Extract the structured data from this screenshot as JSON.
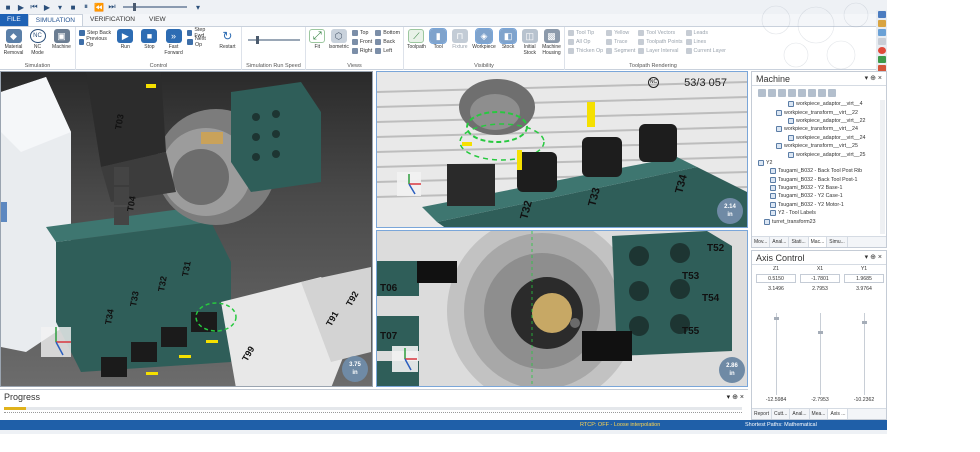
{
  "quick_access": {
    "icons": [
      "play-icon",
      "step-back-icon",
      "play-small-icon",
      "stop-icon",
      "pause-icon",
      "forward-icon",
      "rewind-icon",
      "end-icon",
      "dropdown-icon"
    ],
    "speed_level": 0.2
  },
  "ribbon": {
    "tabs": [
      {
        "label": "FILE",
        "state": "file"
      },
      {
        "label": "SIMULATION",
        "state": "active"
      },
      {
        "label": "VERIFICATION",
        "state": ""
      },
      {
        "label": "VIEW",
        "state": ""
      }
    ],
    "groups": {
      "simulation": {
        "title": "Simulation",
        "buttons": [
          "Material Removal",
          "NC Mode",
          "Machine"
        ]
      },
      "control": {
        "title": "Control",
        "step_back": "Step Back",
        "previous_op": "Previous Op",
        "run": "Run",
        "stop": "Stop",
        "fast_forward": "Fast Forward",
        "step_fwd": "Step Fwd",
        "next_op": "Next Op",
        "restart": "Restart"
      },
      "speed": {
        "title": "Simulation Run Speed",
        "level": 0.15
      },
      "views": {
        "title": "Views",
        "fit": "Fit",
        "isometric": "Isometric",
        "top": "Top",
        "front": "Front",
        "right": "Right",
        "bottom": "Bottom",
        "back": "Back",
        "left": "Left"
      },
      "visibility": {
        "title": "Visibility",
        "buttons": [
          "Toolpath",
          "Tool",
          "Fixture",
          "Workpiece",
          "Stock",
          "Initial Stock",
          "Machine Housing"
        ]
      },
      "toolpath_rendering": {
        "title": "Toolpath Rendering",
        "items": [
          "Tool Tip",
          "Yellow",
          "Tool Vectors",
          "Leads",
          "All Op",
          "Trace",
          "Toolpath Points",
          "Lines",
          "Thicken Op",
          "Segment",
          "Layer Interval",
          "Current Layer"
        ]
      }
    }
  },
  "viewports": {
    "left": {
      "scale": "3.75",
      "unit": "in",
      "tool_labels": [
        "T03",
        "T04",
        "T31",
        "T32",
        "T33",
        "T34",
        "T91",
        "T92",
        "T99"
      ]
    },
    "top_right": {
      "scale": "2.14",
      "unit": "in",
      "counter": "53/3 057",
      "nc_badge": "NC",
      "tool_labels": [
        "T32",
        "T33",
        "T34"
      ]
    },
    "bottom_right": {
      "scale": "2.86",
      "unit": "in",
      "tool_labels": [
        "T52",
        "T53",
        "T54",
        "T55",
        "T06",
        "T07"
      ]
    }
  },
  "machine_panel": {
    "title": "Machine",
    "tree": [
      "workpiece_adaptor__virt__4",
      "workpiece_transform__virt__22",
      "workpiece_adaptor__virt__22",
      "workpiece_transform__virt__24",
      "workpiece_adaptor__virt__24",
      "workpiece_transform__virt__25",
      "workpiece_adaptor__virt__25",
      "Y2",
      "Tsugami_B032 - Back Tool Post Rib",
      "Tsugami_B032 - Back Tool Post-1",
      "Tsugami_B032 - Y2 Base-1",
      "Tsugami_B032 - Y2 Case-1",
      "Tsugami_B032 - Y2 Motor-1",
      "Y2 - Tool Labels",
      "turret_transform23"
    ],
    "tabs": [
      "Mov...",
      "Anal...",
      "Stati...",
      "Mac...",
      "Simu..."
    ]
  },
  "axis_control": {
    "title": "Axis Control",
    "axes": [
      {
        "name": "Z1",
        "value": "0.5150",
        "min": "3.1496",
        "max": "-12.5984"
      },
      {
        "name": "X1",
        "value": "-1.7801",
        "min": "2.7953",
        "max": "-2.7953"
      },
      {
        "name": "Y1",
        "value": "1.9685",
        "min": "3.9764",
        "max": "-10.2362"
      }
    ],
    "tabs": [
      "Report",
      "Cutt...",
      "Anal...",
      "Mea...",
      "Axis ..."
    ]
  },
  "progress": {
    "title": "Progress",
    "fraction": 0.03
  },
  "status_bar": {
    "left": "",
    "middle": "RTCP: OFF - Loose interpolation",
    "right": "Shortest Paths: Mathematical"
  }
}
